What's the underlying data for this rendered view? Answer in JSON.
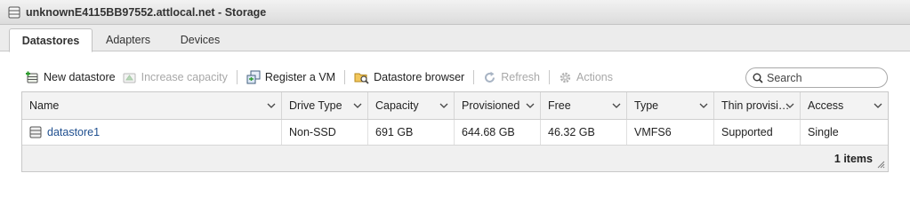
{
  "window": {
    "title": "unknownE4115BB97552.attlocal.net - Storage"
  },
  "tabs": [
    {
      "label": "Datastores",
      "active": true
    },
    {
      "label": "Adapters",
      "active": false
    },
    {
      "label": "Devices",
      "active": false
    }
  ],
  "toolbar": {
    "new_datastore": "New datastore",
    "increase_capacity": "Increase capacity",
    "register_vm": "Register a VM",
    "datastore_browser": "Datastore browser",
    "refresh": "Refresh",
    "actions": "Actions"
  },
  "search": {
    "placeholder": "Search"
  },
  "table": {
    "columns": [
      "Name",
      "Drive Type",
      "Capacity",
      "Provisioned",
      "Free",
      "Type",
      "Thin provisi…",
      "Access"
    ],
    "rows": [
      {
        "name": "datastore1",
        "drive_type": "Non-SSD",
        "capacity": "691 GB",
        "provisioned": "644.68 GB",
        "free": "46.32 GB",
        "type": "VMFS6",
        "thin_provisioning": "Supported",
        "access": "Single"
      }
    ],
    "footer_count": "1 items"
  },
  "colors": {
    "link": "#1f4f8f",
    "disabled_text": "#a8a8a8",
    "header_bg": "#f3f3f3"
  },
  "icons": {
    "title": "storage-icon",
    "new_datastore": "new-datastore-icon",
    "increase_capacity": "increase-capacity-icon",
    "register_vm": "register-vm-icon",
    "datastore_browser": "folder-search-icon",
    "refresh": "refresh-icon",
    "actions": "gear-icon",
    "search": "search-icon",
    "row": "datastore-icon"
  }
}
